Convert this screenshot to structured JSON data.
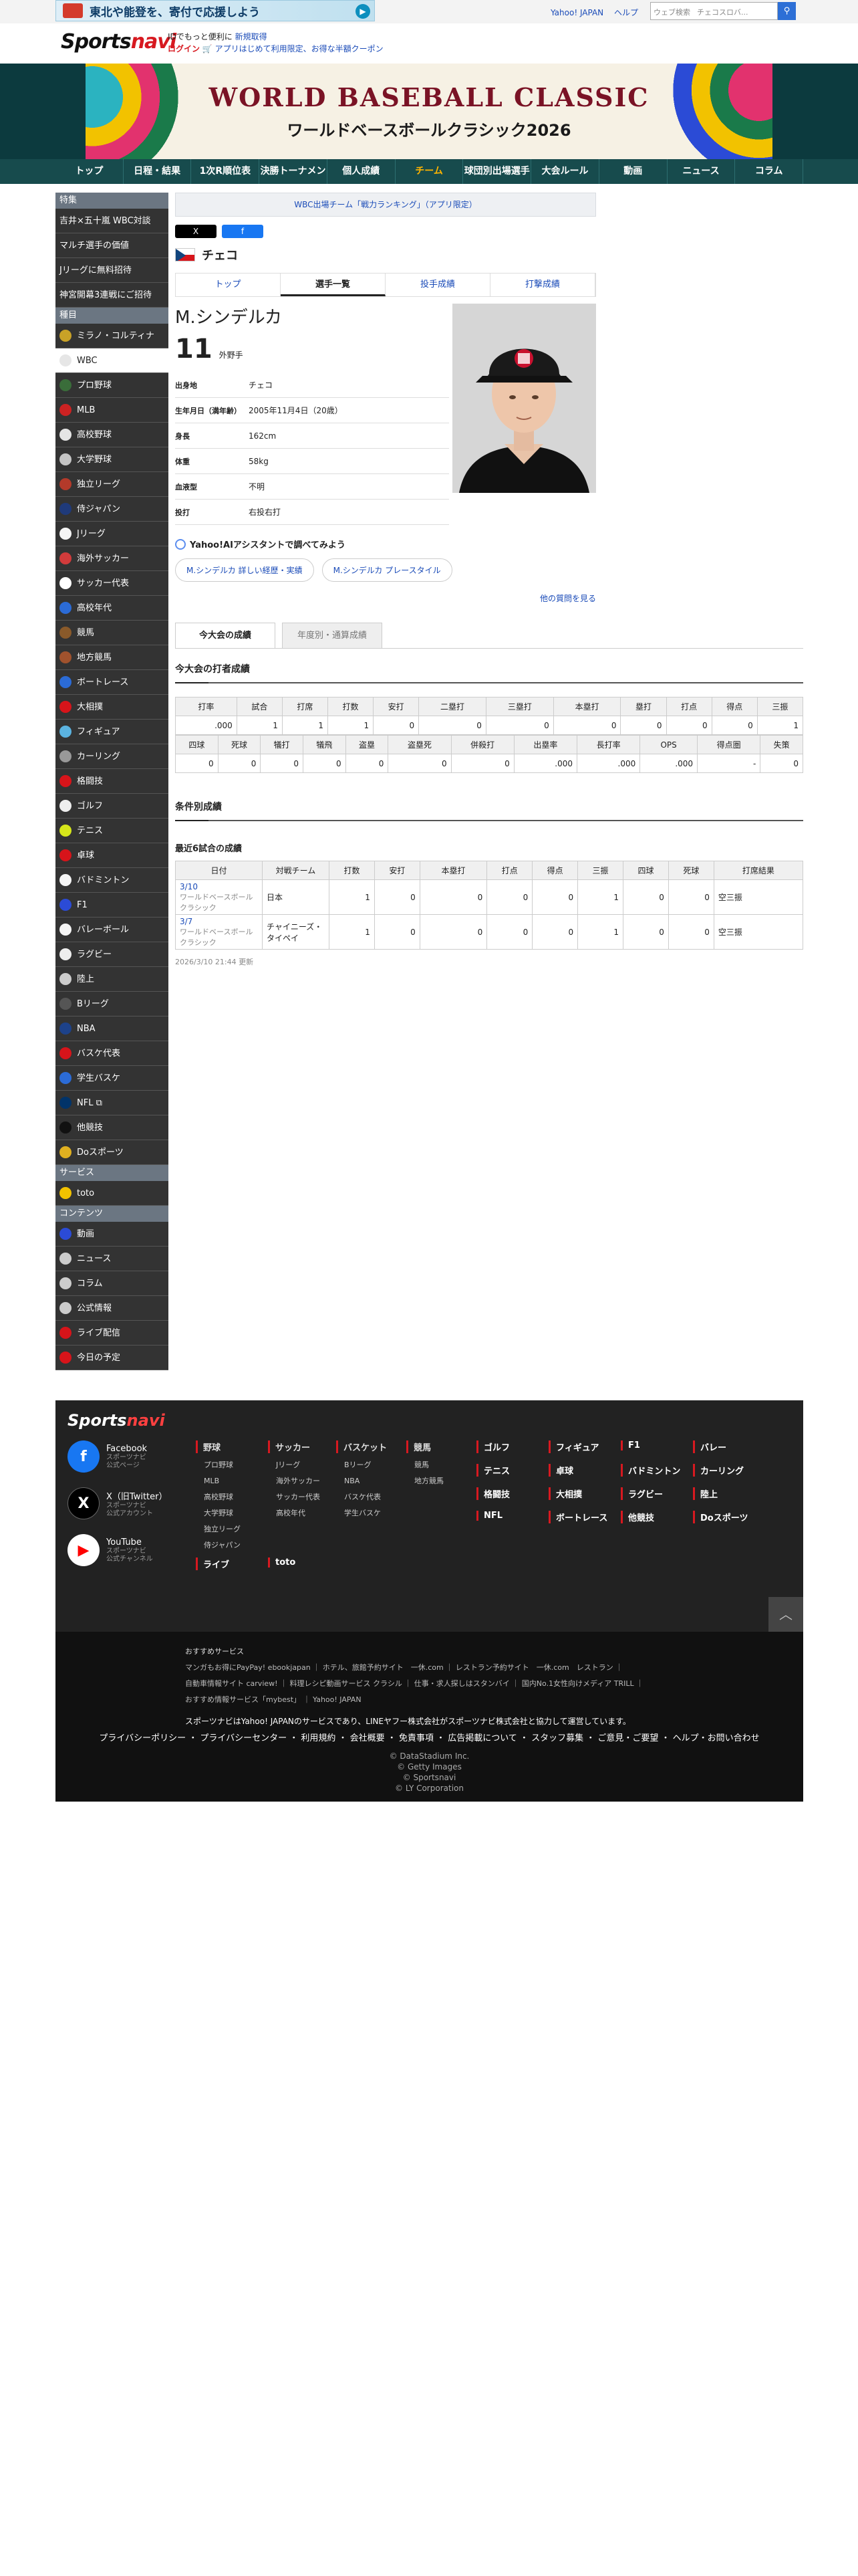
{
  "topbar": {
    "promo_text": "東北や能登を、寄付で応援しよう",
    "links": [
      "Yahoo! JAPAN",
      "ヘルプ"
    ],
    "search_placeholder": "ウェブ検索",
    "search_value": "チェコスロバ..."
  },
  "header": {
    "logo_main": "Sports",
    "logo_accent": "navi",
    "id_line1_prefix": "IDでもっと便利に",
    "id_line1_link": "新規取得",
    "id_line2_login": "ログイン",
    "id_line2_promo": "アプリはじめて利用限定、お得な半額クーポン"
  },
  "banner": {
    "title": "WORLD BASEBALL CLASSIC",
    "subtitle": "ワールドベースボールクラシック2026"
  },
  "gnav": [
    "トップ",
    "日程・結果",
    "1次R順位表",
    "決勝トーナメント",
    "個人成績",
    "チーム",
    "球団別出場選手",
    "大会ルール",
    "動画",
    "ニュース",
    "コラム"
  ],
  "sidebar": {
    "feature_head": "特集",
    "features": [
      "吉井×五十嵐 WBC対談",
      "マルチ選手の価値",
      "Jリーグに無料招待",
      "神宮開幕3連戦にご招待"
    ],
    "sports_head": "種目",
    "sports": [
      {
        "label": "ミラノ・コルティナ",
        "color": "#c9a227"
      },
      {
        "label": "WBC",
        "color": "#e6e6e6"
      },
      {
        "label": "プロ野球",
        "color": "#3a6d3a"
      },
      {
        "label": "MLB",
        "color": "#c22"
      },
      {
        "label": "高校野球",
        "color": "#e5e5e5"
      },
      {
        "label": "大学野球",
        "color": "#c5c5c5"
      },
      {
        "label": "独立リーグ",
        "color": "#b43a2a"
      },
      {
        "label": "侍ジャパン",
        "color": "#1f3a7a"
      },
      {
        "label": "Jリーグ",
        "color": "#f5f5f5"
      },
      {
        "label": "海外サッカー",
        "color": "#d23b3b"
      },
      {
        "label": "サッカー代表",
        "color": "#ffffff"
      },
      {
        "label": "高校年代",
        "color": "#2b6bd6"
      },
      {
        "label": "競馬",
        "color": "#8a5a2a"
      },
      {
        "label": "地方競馬",
        "color": "#a0522d"
      },
      {
        "label": "ボートレース",
        "color": "#2b6bd6"
      },
      {
        "label": "大相撲",
        "color": "#d7141a"
      },
      {
        "label": "フィギュア",
        "color": "#5bb3e0"
      },
      {
        "label": "カーリング",
        "color": "#999"
      },
      {
        "label": "格闘技",
        "color": "#d7141a"
      },
      {
        "label": "ゴルフ",
        "color": "#eee"
      },
      {
        "label": "テニス",
        "color": "#d6e61a"
      },
      {
        "label": "卓球",
        "color": "#d7141a"
      },
      {
        "label": "バドミントン",
        "color": "#f5f5f5"
      },
      {
        "label": "F1",
        "color": "#2b4bd6"
      },
      {
        "label": "バレーボール",
        "color": "#f5f5f5"
      },
      {
        "label": "ラグビー",
        "color": "#eee"
      },
      {
        "label": "陸上",
        "color": "#ccc"
      },
      {
        "label": "Bリーグ",
        "color": "#555"
      },
      {
        "label": "NBA",
        "color": "#1d428a"
      },
      {
        "label": "バスケ代表",
        "color": "#d7141a"
      },
      {
        "label": "学生バスケ",
        "color": "#2b6bd6"
      },
      {
        "label": "NFL ⧉",
        "color": "#013369"
      },
      {
        "label": "他競技",
        "color": "#111"
      },
      {
        "label": "Doスポーツ",
        "color": "#e0b020"
      }
    ],
    "service_head": "サービス",
    "services": [
      {
        "label": "toto",
        "color": "#f2c200"
      }
    ],
    "content_head": "コンテンツ",
    "contents": [
      {
        "label": "動画",
        "color": "#2b4bd6"
      },
      {
        "label": "ニュース",
        "color": "#ccc"
      },
      {
        "label": "コラム",
        "color": "#ccc"
      },
      {
        "label": "公式情報",
        "color": "#ccc"
      },
      {
        "label": "ライブ配信",
        "color": "#d7141a"
      },
      {
        "label": "今日の予定",
        "color": "#d7141a"
      }
    ]
  },
  "main": {
    "notice": "WBC出場チーム「戦力ランキング」（アプリ限定）",
    "share_x": "X",
    "share_fb": "f",
    "team_name": "チェコ",
    "tabs": [
      "トップ",
      "選手一覧",
      "投手成績",
      "打撃成績"
    ],
    "player": {
      "name": "M.シンデルカ",
      "number": "11",
      "position": "外野手",
      "info": [
        {
          "k": "出身地",
          "v": "チェコ"
        },
        {
          "k": "生年月日（満年齢）",
          "v": "2005年11月4日（20歳）"
        },
        {
          "k": "身長",
          "v": "162cm"
        },
        {
          "k": "体重",
          "v": "58kg"
        },
        {
          "k": "血液型",
          "v": "不明"
        },
        {
          "k": "投打",
          "v": "右投右打"
        }
      ]
    },
    "ai_title": "Yahoo!AIアシスタントで調べてみよう",
    "ai_chips": [
      "M.シンデルカ 詳しい経歴・実績",
      "M.シンデルカ プレースタイル"
    ],
    "more_questions": "他の質問を見る",
    "stat_tabs": [
      "今大会の成績",
      "年度別・通算成績"
    ],
    "section_title": "今大会の打者成績",
    "stats1": {
      "headers": [
        "打率",
        "試合",
        "打席",
        "打数",
        "安打",
        "二塁打",
        "三塁打",
        "本塁打",
        "塁打",
        "打点",
        "得点",
        "三振"
      ],
      "values": [
        ".000",
        "1",
        "1",
        "1",
        "0",
        "0",
        "0",
        "0",
        "0",
        "0",
        "0",
        "1"
      ]
    },
    "stats2": {
      "headers": [
        "四球",
        "死球",
        "犠打",
        "犠飛",
        "盗塁",
        "盗塁死",
        "併殺打",
        "出塁率",
        "長打率",
        "OPS",
        "得点圏",
        "失策"
      ],
      "values": [
        "0",
        "0",
        "0",
        "0",
        "0",
        "0",
        "0",
        ".000",
        ".000",
        ".000",
        "-",
        "0"
      ]
    },
    "situational_title": "条件別成績",
    "recent_title": "最近6試合の成績",
    "recent": {
      "headers": [
        "日付",
        "対戦チーム",
        "打数",
        "安打",
        "本塁打",
        "打点",
        "得点",
        "三振",
        "四球",
        "死球",
        "打席結果"
      ],
      "rows": [
        {
          "date": "3/10",
          "comp": "ワールドベースボールクラシック",
          "opp": "日本",
          "vals": [
            "1",
            "0",
            "0",
            "0",
            "0",
            "1",
            "0",
            "0"
          ],
          "result": "空三振"
        },
        {
          "date": "3/7",
          "comp": "ワールドベースボールクラシック",
          "opp": "チャイニーズ・タイペイ",
          "vals": [
            "1",
            "0",
            "0",
            "0",
            "0",
            "1",
            "0",
            "0"
          ],
          "result": "空三振"
        }
      ]
    },
    "updated": "2026/3/10 21:44 更新"
  },
  "footer": {
    "logo_main": "Sports",
    "logo_accent": "navi",
    "social": [
      {
        "icon": "f",
        "title": "Facebook",
        "sub1": "スポーツナビ",
        "sub2": "公式ページ",
        "color": "#1877f2"
      },
      {
        "icon": "X",
        "title": "X（旧Twitter）",
        "sub1": "スポーツナビ",
        "sub2": "公式アカウント",
        "color": "#000000"
      },
      {
        "icon": "▶",
        "title": "YouTube",
        "sub1": "スポーツナビ",
        "sub2": "公式チャンネル",
        "color": "#ff0000"
      }
    ],
    "col_baseball": {
      "head": "野球",
      "items": [
        "プロ野球",
        "MLB",
        "高校野球",
        "大学野球",
        "独立リーグ",
        "侍ジャパン"
      ]
    },
    "col_soccer": {
      "head": "サッカー",
      "items": [
        "Jリーグ",
        "海外サッカー",
        "サッカー代表",
        "高校年代"
      ]
    },
    "col_basket": {
      "head": "バスケット",
      "items": [
        "Bリーグ",
        "NBA",
        "バスケ代表",
        "学生バスケ"
      ]
    },
    "col_keiba": {
      "head": "競馬",
      "items": [
        "競馬",
        "地方競馬"
      ]
    },
    "grid": [
      [
        "ゴルフ",
        "フィギュア",
        "F1",
        "バレー"
      ],
      [
        "テニス",
        "卓球",
        "バドミントン",
        "カーリング"
      ],
      [
        "格闘技",
        "大相撲",
        "ラグビー",
        "陸上"
      ],
      [
        "NFL",
        "ボートレース",
        "他競技",
        "Doスポーツ"
      ]
    ],
    "live": "ライブ",
    "toto": "toto",
    "to_top": "︿"
  },
  "subfooter": {
    "heading": "おすすめサービス",
    "line1": "マンガもお得にPayPay! ebookjapan ｜ ホテル、旅館予約サイト　一休.com ｜ レストラン予約サイト　一休.com　レストラン ｜",
    "line2": "自動車情報サイト carview! ｜ 料理レシピ動画サービス クラシル ｜ 仕事・求人探しはスタンバイ ｜ 国内No.1女性向けメディア TRILL ｜",
    "line3": "おすすめ情報サービス「mybest」 ｜ Yahoo! JAPAN",
    "notice": "スポーツナビはYahoo! JAPANのサービスであり、LINEヤフー株式会社がスポーツナビ株式会社と協力して運営しています。",
    "policy": "プライバシーポリシー ・ プライバシーセンター ・ 利用規約 ・ 会社概要 ・ 免責事項 ・ 広告掲載について ・ スタッフ募集 ・ ご意見・ご要望 ・ ヘルプ・お問い合わせ",
    "copyrights": [
      "© DataStadium Inc.",
      "© Getty Images",
      "© Sportsnavi",
      "© LY Corporation"
    ]
  }
}
